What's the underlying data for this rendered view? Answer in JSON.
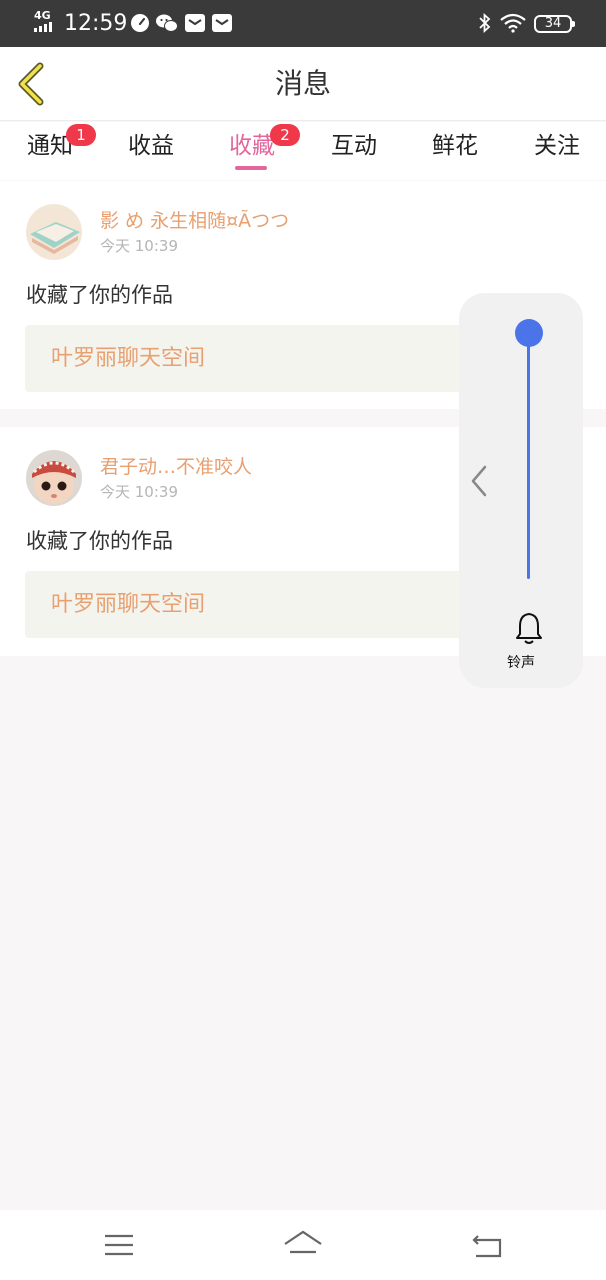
{
  "status_bar": {
    "network": "4G",
    "time": "12:59",
    "battery": "34",
    "icons": [
      "signal-icon",
      "speed-icon",
      "wechat-icon",
      "mail-icon",
      "mail-icon",
      "bluetooth-icon",
      "wifi-icon",
      "battery-icon"
    ]
  },
  "header": {
    "title": "消息",
    "back_icon": "chevron-left-icon"
  },
  "tabs": [
    {
      "label": "通知",
      "badge": "1"
    },
    {
      "label": "收益",
      "badge": ""
    },
    {
      "label": "收藏",
      "badge": "2",
      "active": true
    },
    {
      "label": "互动",
      "badge": ""
    },
    {
      "label": "鲜花",
      "badge": ""
    },
    {
      "label": "关注",
      "badge": ""
    }
  ],
  "messages": [
    {
      "username": "影 め 永生相随¤Ãつつ",
      "time": "今天 10:39",
      "action": "收藏了你的作品",
      "work_title": "叶罗丽聊天空间"
    },
    {
      "username": "君子动…不准咬人",
      "time": "今天 10:39",
      "action": "收藏了你的作品",
      "work_title": "叶罗丽聊天空间"
    }
  ],
  "volume_panel": {
    "label": "铃声",
    "level": 1.0,
    "icon": "bell-icon"
  },
  "nav_bar": {
    "icons": [
      "menu-icon",
      "home-icon",
      "back-icon"
    ]
  },
  "colors": {
    "accent": "#e2679d",
    "badge": "#f0384b",
    "username": "#e8a070",
    "volume": "#4a74e8"
  }
}
